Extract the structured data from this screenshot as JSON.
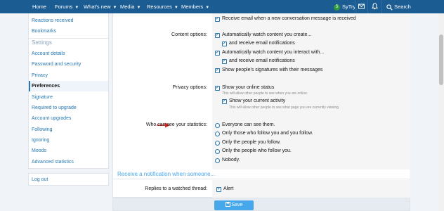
{
  "nav": {
    "items": [
      "Home",
      "Forums",
      "What's new",
      "Media",
      "Resources",
      "Members"
    ],
    "user": "SyTry",
    "user_initial": "S",
    "search": "Search"
  },
  "sidebar": {
    "items_top": [
      "Reactions received",
      "Bookmarks"
    ],
    "heading": "Settings",
    "items": [
      "Account details",
      "Password and security",
      "Privacy",
      "Preferences",
      "Signature",
      "Required to upgrade",
      "Account upgrades",
      "Following",
      "Ignoring",
      "Moods",
      "Advanced statistics"
    ],
    "active": "Preferences",
    "logout": "Log out"
  },
  "form": {
    "email_option": "Receive email when a new conversation message is received",
    "content_label": "Content options:",
    "content_options": [
      "Automatically watch content you create...",
      "and receive email notifications",
      "Automatically watch content you interact with...",
      "and receive email notifications",
      "Show people's signatures with their messages"
    ],
    "privacy_label": "Privacy options:",
    "online_status": "Show your online status",
    "online_hint": "This will allow other people to see when you are online.",
    "current_activity": "Show your current activity",
    "activity_hint": "This will allow other people to see what page you are currently viewing.",
    "stats_label": "Who can see your statistics:",
    "stats_options": [
      "Everyone can see them.",
      "Only those who follow you and you follow.",
      "Only the people you follow.",
      "Only the people who follow you.",
      "Nobody."
    ],
    "notify_heading": "Receive a notification when someone...",
    "replies_label": "Replies to a watched thread:",
    "alert": "Alert"
  },
  "save_label": "Save"
}
